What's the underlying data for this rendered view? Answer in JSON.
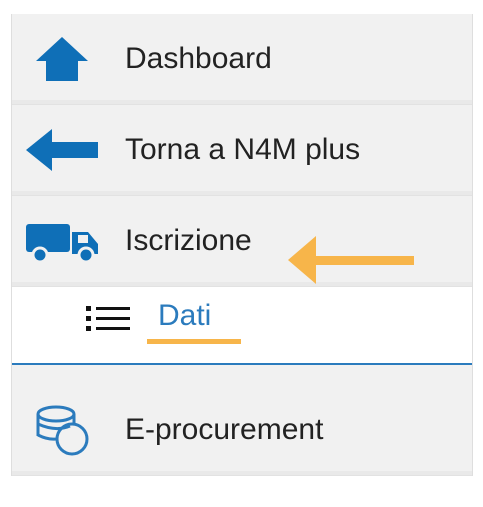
{
  "menu": {
    "items": [
      {
        "label": "Dashboard",
        "icon": "home-icon"
      },
      {
        "label": "Torna a N4M plus",
        "icon": "arrow-left-icon"
      },
      {
        "label": "Iscrizione",
        "icon": "truck-icon"
      }
    ],
    "subitem": {
      "label": "Dati",
      "icon": "list-icon"
    },
    "last": {
      "label": "E-procurement",
      "icon": "coins-icon"
    }
  },
  "colors": {
    "accent": "#0f6fb7",
    "link": "#2b7bbd",
    "annotation": "#f7b54a"
  }
}
